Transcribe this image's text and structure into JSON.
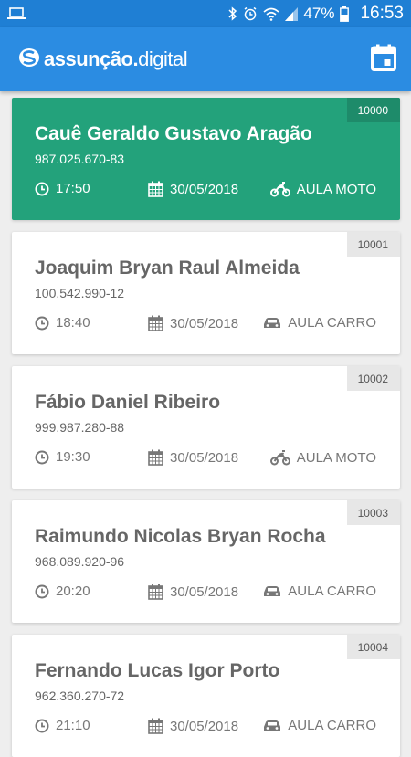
{
  "status_bar": {
    "battery": "47%",
    "time": "16:53"
  },
  "app": {
    "brand_bold": "assunção.",
    "brand_light": "digital",
    "calendar_icon": "calendar-icon"
  },
  "colors": {
    "primary": "#2b8ce2",
    "status_bar": "#1f7fd4",
    "active_card": "#23a27b"
  },
  "appointments": [
    {
      "id": "10000",
      "name": "Cauê Geraldo Gustavo Aragão",
      "cpf": "987.025.670-83",
      "time": "17:50",
      "date": "30/05/2018",
      "type": "AULA MOTO",
      "vehicle": "motorcycle-icon"
    },
    {
      "id": "10001",
      "name": "Joaquim Bryan Raul Almeida",
      "cpf": "100.542.990-12",
      "time": "18:40",
      "date": "30/05/2018",
      "type": "AULA CARRO",
      "vehicle": "car-icon"
    },
    {
      "id": "10002",
      "name": "Fábio Daniel Ribeiro",
      "cpf": "999.987.280-88",
      "time": "19:30",
      "date": "30/05/2018",
      "type": "AULA MOTO",
      "vehicle": "motorcycle-icon"
    },
    {
      "id": "10003",
      "name": "Raimundo Nicolas Bryan Rocha",
      "cpf": "968.089.920-96",
      "time": "20:20",
      "date": "30/05/2018",
      "type": "AULA CARRO",
      "vehicle": "car-icon"
    },
    {
      "id": "10004",
      "name": "Fernando Lucas Igor Porto",
      "cpf": "962.360.270-72",
      "time": "21:10",
      "date": "30/05/2018",
      "type": "AULA CARRO",
      "vehicle": "car-icon"
    }
  ]
}
